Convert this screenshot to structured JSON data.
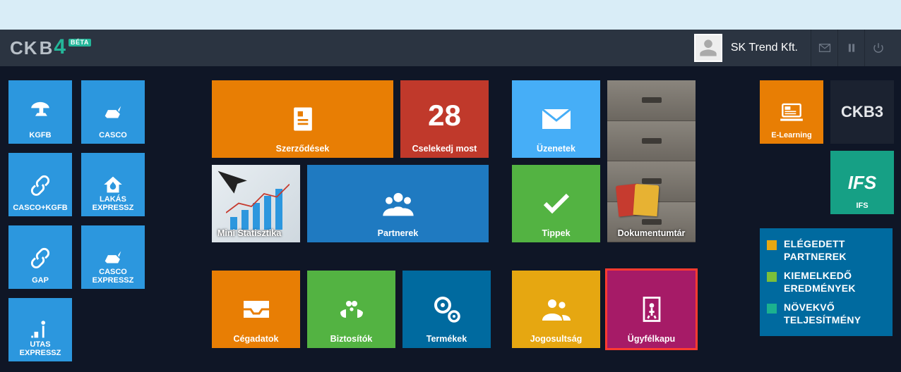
{
  "header": {
    "logo_ck": "CK",
    "logo_b": "B",
    "logo_four": "4",
    "logo_beta": "BÉTA",
    "user_name": "SK Trend Kft."
  },
  "tiles": {
    "kgfb": "KGFB",
    "casco": "CASCO",
    "casco_kgfb": "CASCO+KGFB",
    "lakas": "LAKÁS EXPRESSZ",
    "gap": "GAP",
    "casco_exp": "CASCO EXPRESSZ",
    "utas": "UTAS EXPRESSZ",
    "szerzodesek": "Szerződések",
    "cselekedj_num": "28",
    "cselekedj": "Cselekedj most",
    "uzenetek": "Üzenetek",
    "mini_stat": "Mini Statisztika",
    "partnerek": "Partnerek",
    "tippek": "Tippek",
    "dokutar": "Dokumentumtár",
    "cegadatok": "Cégadatok",
    "biztositok": "Biztosítók",
    "termekek": "Termékek",
    "jogosultsag": "Jogosultság",
    "ugyfelkapu": "Ügyfélkapu",
    "elearning": "E-Learning",
    "ckb3": "CKB3",
    "ifs_big": "IFS",
    "ifs": "IFS"
  },
  "side_panel": {
    "l1": "ELÉGEDETT PARTNEREK",
    "l2": "KIEMELKEDŐ EREDMÉNYEK",
    "l3": "NÖVEKVŐ TELJESÍTMÉNY"
  }
}
